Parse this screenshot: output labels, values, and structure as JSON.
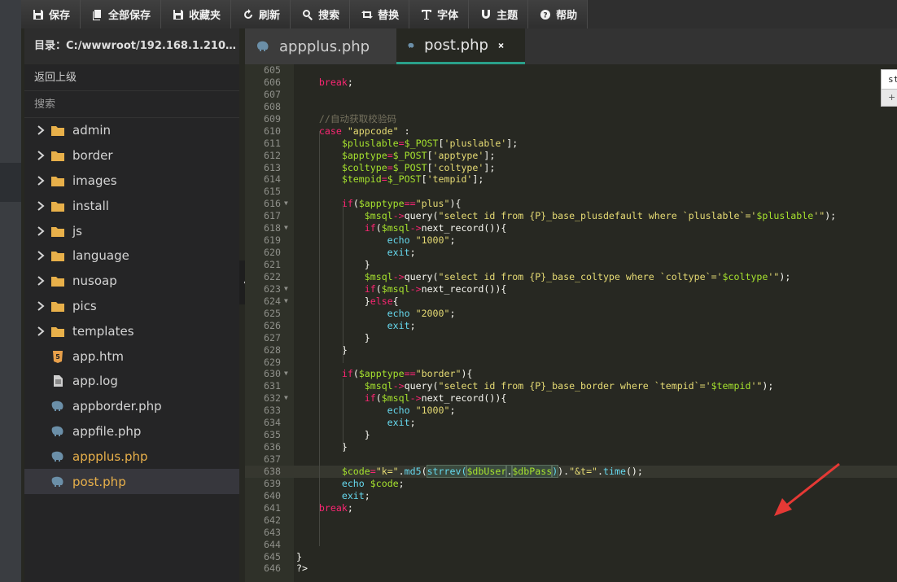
{
  "toolbar": {
    "save": "保存",
    "save_all": "全部保存",
    "favorites": "收藏夹",
    "refresh": "刷新",
    "search": "搜索",
    "replace": "替换",
    "font": "字体",
    "theme": "主题",
    "help": "帮助"
  },
  "sidebar": {
    "directory": "目录：C:/wwwroot/192.168.1.210/ba...",
    "back": "返回上级",
    "search": "搜索",
    "items": [
      {
        "label": "admin",
        "type": "folder"
      },
      {
        "label": "border",
        "type": "folder"
      },
      {
        "label": "images",
        "type": "folder"
      },
      {
        "label": "install",
        "type": "folder"
      },
      {
        "label": "js",
        "type": "folder"
      },
      {
        "label": "language",
        "type": "folder"
      },
      {
        "label": "nusoap",
        "type": "folder"
      },
      {
        "label": "pics",
        "type": "folder"
      },
      {
        "label": "templates",
        "type": "folder"
      },
      {
        "label": "app.htm",
        "type": "html-file"
      },
      {
        "label": "app.log",
        "type": "text-file"
      },
      {
        "label": "appborder.php",
        "type": "php-file"
      },
      {
        "label": "appfile.php",
        "type": "php-file"
      },
      {
        "label": "appplus.php",
        "type": "php-file-open"
      },
      {
        "label": "post.php",
        "type": "php-file-selected"
      }
    ]
  },
  "tabs": [
    {
      "label": "appplus.php"
    },
    {
      "label": "post.php"
    }
  ],
  "widget": {
    "input_value": "st",
    "plus": "+"
  },
  "colors": {
    "editor_bg": "#272822",
    "accent": "#e8b04a",
    "tab_active_border": "#2aa08a",
    "arrow": "#e53935"
  },
  "code": [
    {
      "n": "605",
      "fold": false,
      "segs": []
    },
    {
      "n": "606",
      "fold": false,
      "segs": [
        {
          "c": "kw",
          "t": "    break"
        },
        {
          "c": "",
          "t": ";"
        }
      ]
    },
    {
      "n": "607",
      "fold": false,
      "segs": []
    },
    {
      "n": "608",
      "fold": false,
      "segs": []
    },
    {
      "n": "609",
      "fold": false,
      "segs": [
        {
          "c": "cm",
          "t": "    //自动获取校验码"
        }
      ]
    },
    {
      "n": "610",
      "fold": false,
      "segs": [
        {
          "c": "kw",
          "t": "    case "
        },
        {
          "c": "st",
          "t": "\"appcode\""
        },
        {
          "c": "",
          "t": " :"
        }
      ]
    },
    {
      "n": "611",
      "fold": false,
      "segs": [
        {
          "c": "va",
          "t": "        $pluslable"
        },
        {
          "c": "op",
          "t": "="
        },
        {
          "c": "va",
          "t": "$_POST"
        },
        {
          "c": "",
          "t": "["
        },
        {
          "c": "st",
          "t": "'pluslable'"
        },
        {
          "c": "",
          "t": "];"
        }
      ]
    },
    {
      "n": "612",
      "fold": false,
      "segs": [
        {
          "c": "va",
          "t": "        $apptype"
        },
        {
          "c": "op",
          "t": "="
        },
        {
          "c": "va",
          "t": "$_POST"
        },
        {
          "c": "",
          "t": "["
        },
        {
          "c": "st",
          "t": "'apptype'"
        },
        {
          "c": "",
          "t": "];"
        }
      ]
    },
    {
      "n": "613",
      "fold": false,
      "segs": [
        {
          "c": "va",
          "t": "        $coltype"
        },
        {
          "c": "op",
          "t": "="
        },
        {
          "c": "va",
          "t": "$_POST"
        },
        {
          "c": "",
          "t": "["
        },
        {
          "c": "st",
          "t": "'coltype'"
        },
        {
          "c": "",
          "t": "];"
        }
      ]
    },
    {
      "n": "614",
      "fold": false,
      "segs": [
        {
          "c": "va",
          "t": "        $tempid"
        },
        {
          "c": "op",
          "t": "="
        },
        {
          "c": "va",
          "t": "$_POST"
        },
        {
          "c": "",
          "t": "["
        },
        {
          "c": "st",
          "t": "'tempid'"
        },
        {
          "c": "",
          "t": "];"
        }
      ]
    },
    {
      "n": "615",
      "fold": false,
      "segs": []
    },
    {
      "n": "616",
      "fold": true,
      "segs": [
        {
          "c": "kw",
          "t": "        if"
        },
        {
          "c": "",
          "t": "("
        },
        {
          "c": "va",
          "t": "$apptype"
        },
        {
          "c": "op",
          "t": "=="
        },
        {
          "c": "st",
          "t": "\"plus\""
        },
        {
          "c": "",
          "t": "){"
        }
      ]
    },
    {
      "n": "617",
      "fold": false,
      "segs": [
        {
          "c": "va",
          "t": "            $msql"
        },
        {
          "c": "op",
          "t": "->"
        },
        {
          "c": "",
          "t": "query("
        },
        {
          "c": "st",
          "t": "\"select id from {P}_base_plusdefault where `pluslable`='"
        },
        {
          "c": "va",
          "t": "$pluslable"
        },
        {
          "c": "st",
          "t": "'\""
        },
        {
          "c": "",
          "t": ");"
        }
      ]
    },
    {
      "n": "618",
      "fold": true,
      "segs": [
        {
          "c": "kw",
          "t": "            if"
        },
        {
          "c": "",
          "t": "("
        },
        {
          "c": "va",
          "t": "$msql"
        },
        {
          "c": "op",
          "t": "->"
        },
        {
          "c": "",
          "t": "next_record()){"
        }
      ]
    },
    {
      "n": "619",
      "fold": false,
      "segs": [
        {
          "c": "fn",
          "t": "                echo "
        },
        {
          "c": "st",
          "t": "\"1000\""
        },
        {
          "c": "",
          "t": ";"
        }
      ]
    },
    {
      "n": "620",
      "fold": false,
      "segs": [
        {
          "c": "fn",
          "t": "                exit"
        },
        {
          "c": "",
          "t": ";"
        }
      ]
    },
    {
      "n": "621",
      "fold": false,
      "segs": [
        {
          "c": "",
          "t": "            }"
        }
      ]
    },
    {
      "n": "622",
      "fold": false,
      "segs": [
        {
          "c": "va",
          "t": "            $msql"
        },
        {
          "c": "op",
          "t": "->"
        },
        {
          "c": "",
          "t": "query("
        },
        {
          "c": "st",
          "t": "\"select id from {P}_base_coltype where `coltype`='"
        },
        {
          "c": "va",
          "t": "$coltype"
        },
        {
          "c": "st",
          "t": "'\""
        },
        {
          "c": "",
          "t": ");"
        }
      ]
    },
    {
      "n": "623",
      "fold": true,
      "segs": [
        {
          "c": "kw",
          "t": "            if"
        },
        {
          "c": "",
          "t": "("
        },
        {
          "c": "va",
          "t": "$msql"
        },
        {
          "c": "op",
          "t": "->"
        },
        {
          "c": "",
          "t": "next_record()){"
        }
      ]
    },
    {
      "n": "624",
      "fold": true,
      "segs": [
        {
          "c": "",
          "t": "            }"
        },
        {
          "c": "kw",
          "t": "else"
        },
        {
          "c": "",
          "t": "{"
        }
      ]
    },
    {
      "n": "625",
      "fold": false,
      "segs": [
        {
          "c": "fn",
          "t": "                echo "
        },
        {
          "c": "st",
          "t": "\"2000\""
        },
        {
          "c": "",
          "t": ";"
        }
      ]
    },
    {
      "n": "626",
      "fold": false,
      "segs": [
        {
          "c": "fn",
          "t": "                exit"
        },
        {
          "c": "",
          "t": ";"
        }
      ]
    },
    {
      "n": "627",
      "fold": false,
      "segs": [
        {
          "c": "",
          "t": "            }"
        }
      ]
    },
    {
      "n": "628",
      "fold": false,
      "segs": [
        {
          "c": "",
          "t": "        }"
        }
      ]
    },
    {
      "n": "629",
      "fold": false,
      "segs": []
    },
    {
      "n": "630",
      "fold": true,
      "segs": [
        {
          "c": "kw",
          "t": "        if"
        },
        {
          "c": "",
          "t": "("
        },
        {
          "c": "va",
          "t": "$apptype"
        },
        {
          "c": "op",
          "t": "=="
        },
        {
          "c": "st",
          "t": "\"border\""
        },
        {
          "c": "",
          "t": "){"
        }
      ]
    },
    {
      "n": "631",
      "fold": false,
      "segs": [
        {
          "c": "va",
          "t": "            $msql"
        },
        {
          "c": "op",
          "t": "->"
        },
        {
          "c": "",
          "t": "query("
        },
        {
          "c": "st",
          "t": "\"select id from {P}_base_border where `tempid`='"
        },
        {
          "c": "va",
          "t": "$tempid"
        },
        {
          "c": "st",
          "t": "'\""
        },
        {
          "c": "",
          "t": ");"
        }
      ]
    },
    {
      "n": "632",
      "fold": true,
      "segs": [
        {
          "c": "kw",
          "t": "            if"
        },
        {
          "c": "",
          "t": "("
        },
        {
          "c": "va",
          "t": "$msql"
        },
        {
          "c": "op",
          "t": "->"
        },
        {
          "c": "",
          "t": "next_record()){"
        }
      ]
    },
    {
      "n": "633",
      "fold": false,
      "segs": [
        {
          "c": "fn",
          "t": "                echo "
        },
        {
          "c": "st",
          "t": "\"1000\""
        },
        {
          "c": "",
          "t": ";"
        }
      ]
    },
    {
      "n": "634",
      "fold": false,
      "segs": [
        {
          "c": "fn",
          "t": "                exit"
        },
        {
          "c": "",
          "t": ";"
        }
      ]
    },
    {
      "n": "635",
      "fold": false,
      "segs": [
        {
          "c": "",
          "t": "            }"
        }
      ]
    },
    {
      "n": "636",
      "fold": false,
      "segs": [
        {
          "c": "",
          "t": "        }"
        }
      ]
    },
    {
      "n": "637",
      "fold": false,
      "segs": []
    },
    {
      "n": "638",
      "fold": false,
      "active": true,
      "segs": [
        {
          "c": "va",
          "t": "        $code"
        },
        {
          "c": "op",
          "t": "="
        },
        {
          "c": "st",
          "t": "\"k=\""
        },
        {
          "c": "",
          "t": "."
        },
        {
          "c": "fn",
          "t": "md5"
        },
        {
          "c": "",
          "t": "("
        },
        {
          "c": "fn hl",
          "t": "strrev("
        },
        {
          "c": "va hl",
          "t": "$dbUser"
        },
        {
          "c": "hl",
          "t": "."
        },
        {
          "c": "va hl",
          "t": "$dbPass"
        },
        {
          "c": "fn hl",
          "t": ")"
        },
        {
          "c": "",
          "t": ")."
        },
        {
          "c": "st",
          "t": "\"&t=\""
        },
        {
          "c": "",
          "t": "."
        },
        {
          "c": "fn",
          "t": "time"
        },
        {
          "c": "",
          "t": "();"
        }
      ]
    },
    {
      "n": "639",
      "fold": false,
      "segs": [
        {
          "c": "fn",
          "t": "        echo "
        },
        {
          "c": "va",
          "t": "$code"
        },
        {
          "c": "",
          "t": ";"
        }
      ]
    },
    {
      "n": "640",
      "fold": false,
      "segs": [
        {
          "c": "fn",
          "t": "        exit"
        },
        {
          "c": "",
          "t": ";"
        }
      ]
    },
    {
      "n": "641",
      "fold": false,
      "segs": [
        {
          "c": "kw",
          "t": "    break"
        },
        {
          "c": "",
          "t": ";"
        }
      ]
    },
    {
      "n": "642",
      "fold": false,
      "segs": []
    },
    {
      "n": "643",
      "fold": false,
      "segs": []
    },
    {
      "n": "644",
      "fold": false,
      "segs": []
    },
    {
      "n": "645",
      "fold": false,
      "segs": [
        {
          "c": "",
          "t": "}"
        }
      ]
    },
    {
      "n": "646",
      "fold": false,
      "segs": [
        {
          "c": "",
          "t": "?>"
        }
      ]
    }
  ]
}
